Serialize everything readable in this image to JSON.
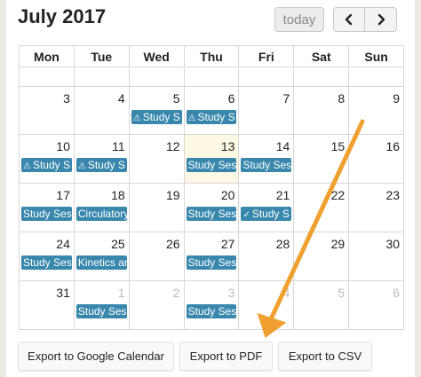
{
  "header": {
    "title": "July 2017",
    "today_label": "today",
    "prev_icon": "chevron-left-icon",
    "next_icon": "chevron-right-icon"
  },
  "weekdays": [
    "Mon",
    "Tue",
    "Wed",
    "Thu",
    "Fri",
    "Sat",
    "Sun"
  ],
  "weeks": [
    {
      "days": [
        {
          "n": "",
          "other": false
        },
        {
          "n": "",
          "other": false
        },
        {
          "n": "",
          "other": false
        },
        {
          "n": "",
          "other": false
        },
        {
          "n": "",
          "other": false
        },
        {
          "n": "",
          "other": false
        },
        {
          "n": "",
          "other": false
        }
      ]
    },
    {
      "days": [
        {
          "n": "3"
        },
        {
          "n": "4"
        },
        {
          "n": "5",
          "event": {
            "icon": "warning-icon",
            "glyph": "⚠",
            "label": "Study S"
          }
        },
        {
          "n": "6",
          "event": {
            "icon": "warning-icon",
            "glyph": "⚠",
            "label": "Study S"
          }
        },
        {
          "n": "7"
        },
        {
          "n": "8"
        },
        {
          "n": "9"
        }
      ]
    },
    {
      "days": [
        {
          "n": "10",
          "event": {
            "icon": "warning-icon",
            "glyph": "⚠",
            "label": "Study S"
          }
        },
        {
          "n": "11",
          "event": {
            "icon": "warning-icon",
            "glyph": "⚠",
            "label": "Study S"
          }
        },
        {
          "n": "12"
        },
        {
          "n": "13",
          "today": true,
          "event": {
            "label": "Study Ses"
          }
        },
        {
          "n": "14",
          "event": {
            "label": "Study Ses"
          }
        },
        {
          "n": "15"
        },
        {
          "n": "16"
        }
      ]
    },
    {
      "days": [
        {
          "n": "17",
          "event": {
            "label": "Study Ses"
          }
        },
        {
          "n": "18",
          "event": {
            "label": "Circulatory"
          }
        },
        {
          "n": "19"
        },
        {
          "n": "20",
          "event": {
            "label": "Study Ses"
          }
        },
        {
          "n": "21",
          "event": {
            "icon": "check-icon",
            "glyph": "✓",
            "label": "Study S"
          }
        },
        {
          "n": "22"
        },
        {
          "n": "23"
        }
      ]
    },
    {
      "days": [
        {
          "n": "24",
          "event": {
            "label": "Study Ses"
          }
        },
        {
          "n": "25",
          "event": {
            "label": "Kinetics ar"
          }
        },
        {
          "n": "26"
        },
        {
          "n": "27",
          "event": {
            "label": "Study Ses"
          }
        },
        {
          "n": "28"
        },
        {
          "n": "29"
        },
        {
          "n": "30"
        }
      ]
    },
    {
      "days": [
        {
          "n": "31"
        },
        {
          "n": "1",
          "other": true,
          "event": {
            "label": "Study Ses"
          }
        },
        {
          "n": "2",
          "other": true
        },
        {
          "n": "3",
          "other": true,
          "event": {
            "label": "Study Ses"
          }
        },
        {
          "n": "4",
          "other": true
        },
        {
          "n": "5",
          "other": true
        },
        {
          "n": "6",
          "other": true
        }
      ]
    }
  ],
  "export": {
    "google_label": "Export to Google Calendar",
    "pdf_label": "Export to PDF",
    "csv_label": "Export to CSV"
  },
  "colors": {
    "event": "#3a87ad",
    "today_bg": "#fcf8e3",
    "arrow": "#f0a030"
  }
}
